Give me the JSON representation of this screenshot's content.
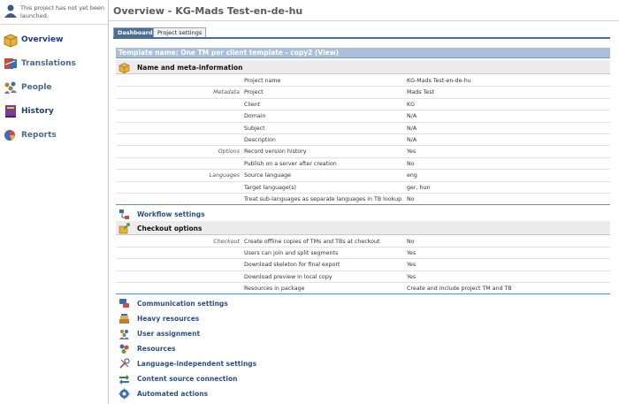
{
  "sidebar": {
    "status_text": "This project has not yet been launched.",
    "items": [
      {
        "label": "Overview",
        "icon": "box-icon"
      },
      {
        "label": "Translations",
        "icon": "translate-icon"
      },
      {
        "label": "People",
        "icon": "people-icon"
      },
      {
        "label": "History",
        "icon": "book-icon"
      },
      {
        "label": "Reports",
        "icon": "chart-icon"
      }
    ]
  },
  "header": {
    "title": "Overview - KG-Mads Test-en-de-hu"
  },
  "tabs": [
    {
      "label": "Dashboard",
      "active": true
    },
    {
      "label": "Project settings",
      "active": false
    }
  ],
  "template_bar": "Template name: One TM per client template - copy2  (View)",
  "sections": {
    "name_meta": "Name and meta-information",
    "workflow": "Workflow settings",
    "checkout": "Checkout options",
    "collapsed": [
      "Communication settings",
      "Heavy resources",
      "User assignment",
      "Resources",
      "Language-independent settings",
      "Content source connection",
      "Automated actions"
    ]
  },
  "meta_rows": [
    {
      "group": "",
      "key": "Project name",
      "value": "KG-Mads Test-en-de-hu"
    },
    {
      "group": "Metadata",
      "key": "Project",
      "value": "Mads Test"
    },
    {
      "group": "",
      "key": "Client",
      "value": "KG"
    },
    {
      "group": "",
      "key": "Domain",
      "value": "N/A"
    },
    {
      "group": "",
      "key": "Subject",
      "value": "N/A"
    },
    {
      "group": "",
      "key": "Description",
      "value": "N/A"
    },
    {
      "group": "Options",
      "key": "Record version history",
      "value": "Yes"
    },
    {
      "group": "",
      "key": "Publish on a server after creation",
      "value": "No"
    },
    {
      "group": "Languages",
      "key": "Source language",
      "value": "eng"
    },
    {
      "group": "",
      "key": "Target language(s)",
      "value": "ger, hun"
    },
    {
      "group": "",
      "key": "Treat sub-languages as separate languages in TB lookup",
      "value": "No"
    }
  ],
  "checkout_rows": [
    {
      "group": "Checkout",
      "key": "Create offline copies of TMs and TBs at checkout",
      "value": "No"
    },
    {
      "group": "",
      "key": "Users can join and split segments",
      "value": "Yes"
    },
    {
      "group": "",
      "key": "Download skeleton for final export",
      "value": "Yes"
    },
    {
      "group": "",
      "key": "Download preview in local copy",
      "value": "Yes"
    },
    {
      "group": "",
      "key": "Resources in package",
      "value": "Create and include project TM and TB"
    }
  ],
  "colors": {
    "accent": "#4b6e95",
    "link": "#2c4f86",
    "template_bar": "#a8c0dc"
  }
}
